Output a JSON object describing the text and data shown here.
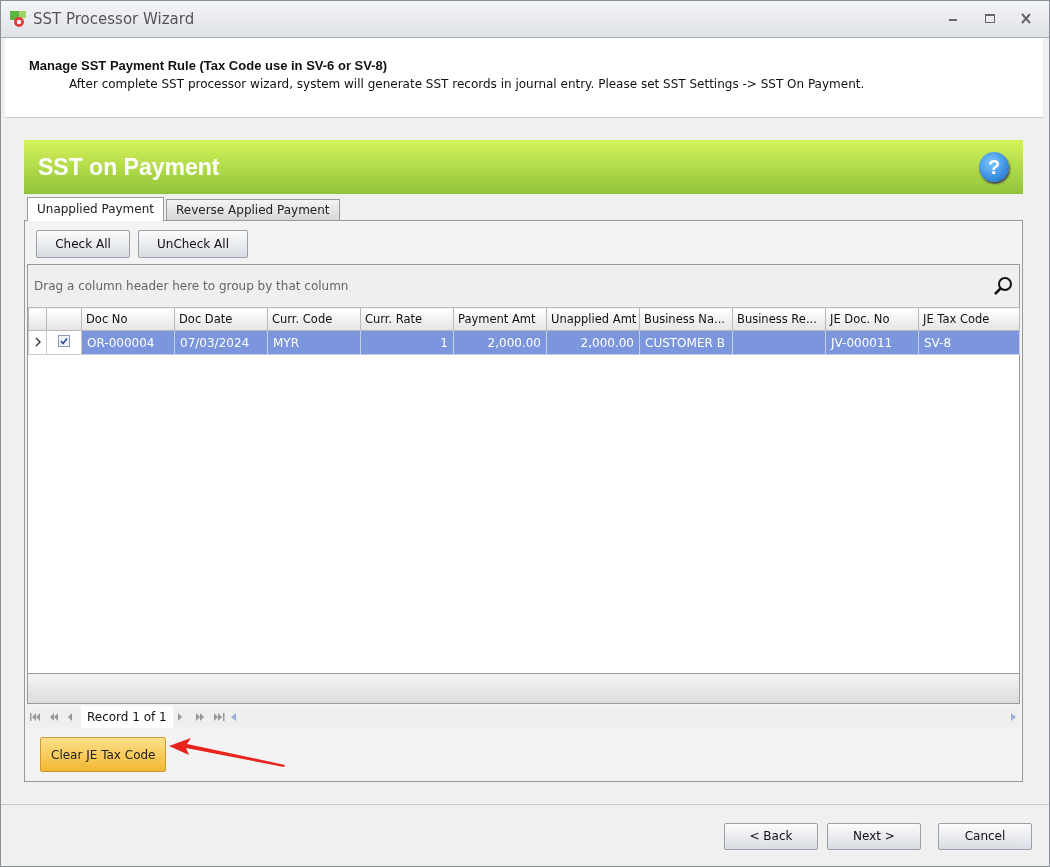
{
  "window": {
    "title": "SST Processor Wizard"
  },
  "header": {
    "title": "Manage SST Payment Rule (Tax Code use in SV-6 or SV-8)",
    "description": "After complete SST processor wizard, system will generate SST records in journal entry. Please set SST Settings -> SST On Payment."
  },
  "banner": {
    "title": "SST on Payment",
    "help_icon": "?"
  },
  "tabs": [
    {
      "label": "Unapplied Payment",
      "selected": true
    },
    {
      "label": "Reverse Applied Payment",
      "selected": false
    }
  ],
  "toolbar": [
    "Check All",
    "UnCheck All"
  ],
  "grid": {
    "group_hint": "Drag a column header here to group by that column",
    "columns": [
      {
        "label": "Doc No",
        "kind": "text"
      },
      {
        "label": "Doc Date",
        "kind": "text"
      },
      {
        "label": "Curr. Code",
        "kind": "text"
      },
      {
        "label": "Curr. Rate",
        "kind": "number"
      },
      {
        "label": "Payment Amt",
        "kind": "number"
      },
      {
        "label": "Unapplied Amt",
        "kind": "number"
      },
      {
        "label": "Business Na...",
        "kind": "text"
      },
      {
        "label": "Business Re...",
        "kind": "text"
      },
      {
        "label": "JE Doc. No",
        "kind": "text"
      },
      {
        "label": "JE Tax Code",
        "kind": "text"
      }
    ],
    "rows": [
      {
        "selected": true,
        "checked": true,
        "current": true,
        "cells": [
          "OR-000004",
          "07/03/2024",
          "MYR",
          "1",
          "2,000.00",
          "2,000.00",
          "CUSTOMER B",
          null,
          "JV-000011",
          "SV-8"
        ]
      }
    ],
    "navigator": "Record 1 of 1"
  },
  "action_button": "Clear JE Tax Code",
  "buttons": [
    "< Back",
    "Next >",
    "Cancel"
  ]
}
